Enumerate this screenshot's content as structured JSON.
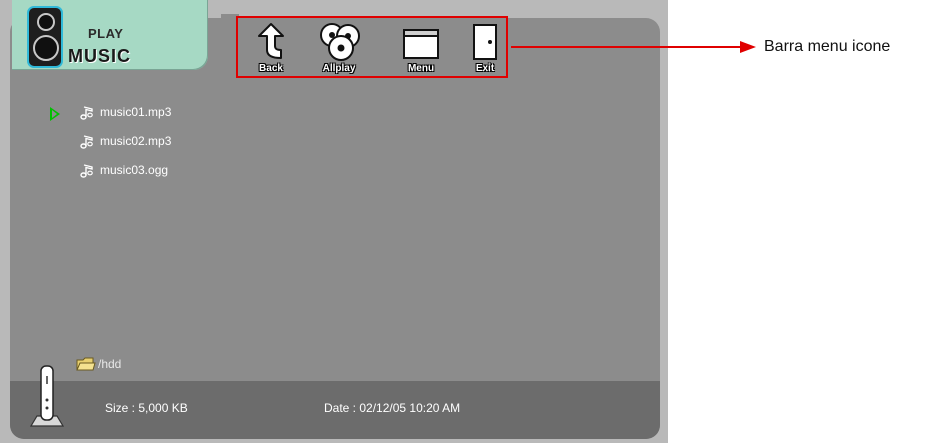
{
  "app": {
    "logo_top": "PLAY",
    "logo_bottom": "MUSIC"
  },
  "toolbar": {
    "items": [
      {
        "label": "Back",
        "icon": "back-arrow-icon"
      },
      {
        "label": "Allplay",
        "icon": "discs-icon"
      },
      {
        "label": "Menu",
        "icon": "menu-window-icon"
      },
      {
        "label": "Exit",
        "icon": "door-icon"
      }
    ]
  },
  "files": [
    {
      "name": "music01.mp3",
      "playing": true
    },
    {
      "name": "music02.mp3",
      "playing": false
    },
    {
      "name": "music03.ogg",
      "playing": false
    }
  ],
  "path": "/hdd",
  "info": {
    "size": "Size : 5,000 KB",
    "date": "Date : 02/12/05  10:20  AM"
  },
  "annotation": {
    "label": "Barra menu icone"
  },
  "colors": {
    "accent_highlight": "#e00000",
    "logo_tab": "#a6d9c4",
    "playing_indicator": "#00c000"
  }
}
